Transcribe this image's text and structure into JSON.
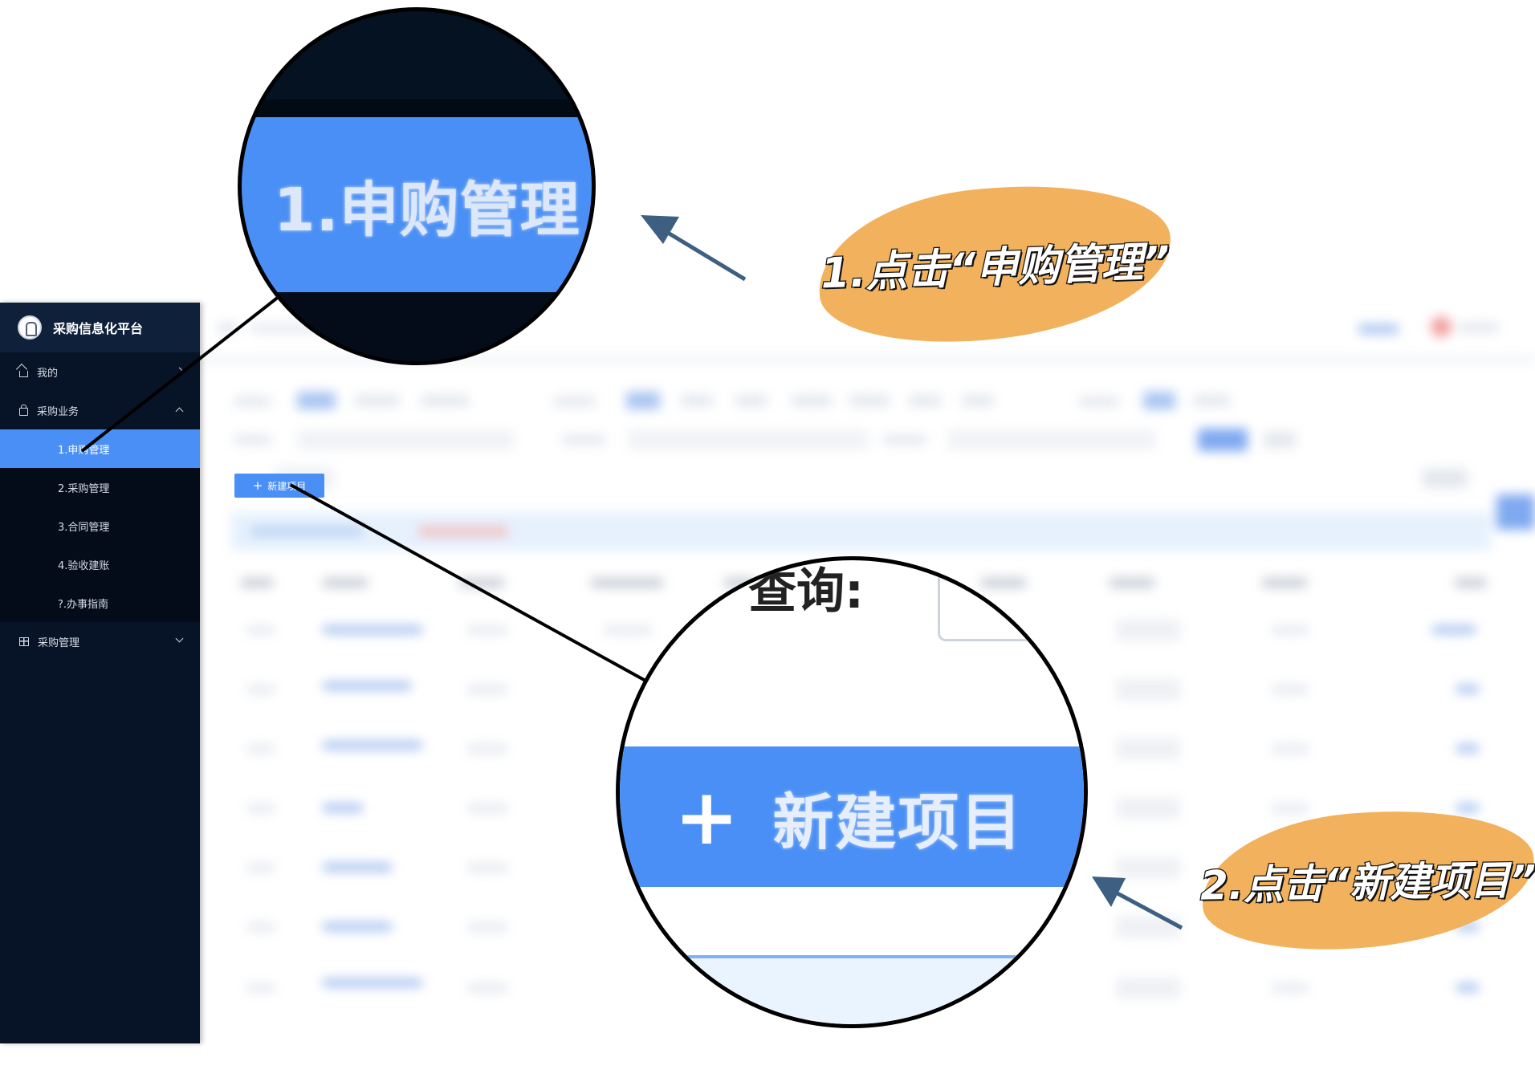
{
  "sidebar": {
    "app_title": "采购信息化平台",
    "items": [
      {
        "label": "我的"
      },
      {
        "label": "采购业务"
      },
      {
        "label": "1.申购管理"
      },
      {
        "label": "2.采购管理"
      },
      {
        "label": "3.合同管理"
      },
      {
        "label": "4.验收建账"
      },
      {
        "label": "?.办事指南"
      },
      {
        "label": "采购管理"
      }
    ]
  },
  "toolbar": {
    "new_project_label": "新建项目",
    "plus_glyph": "+"
  },
  "magnifier1": {
    "label": "1.申购管理"
  },
  "magnifier2": {
    "plus_glyph": "+",
    "label": "新建项目",
    "ghost_text": "查询:"
  },
  "annotations": {
    "step1": "1.点击“申购管理”",
    "step2": "2.点击“新建项目”"
  },
  "colors": {
    "sidebar_bg": "#071326",
    "accent_blue": "#4a8ff5",
    "callout_orange": "#f2b15c",
    "arrow_color": "#3d5f82"
  }
}
